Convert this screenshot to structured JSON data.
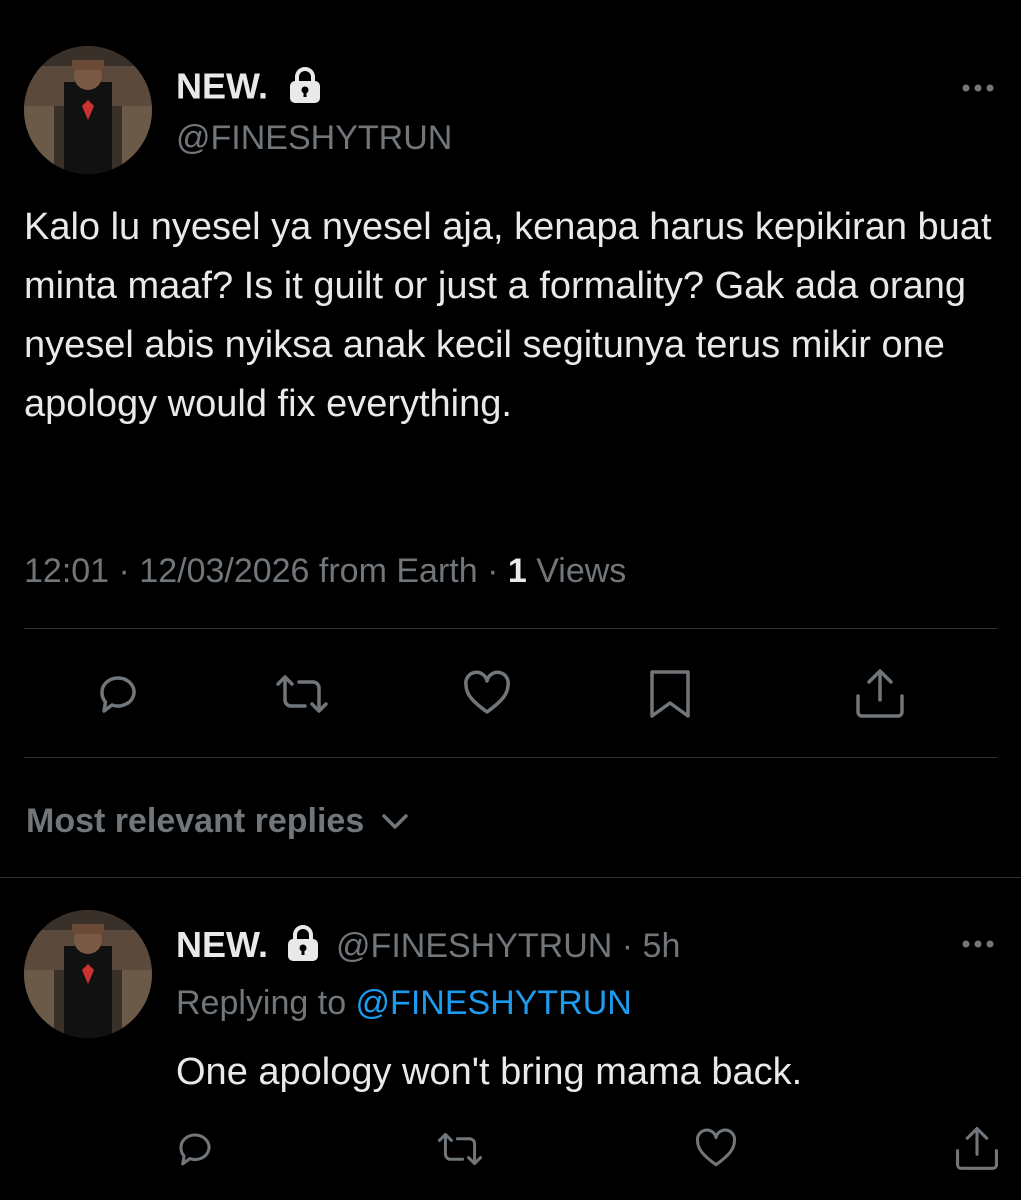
{
  "tweet": {
    "display_name": "NEW.",
    "handle": "@FINESHYTRUN",
    "text": "Kalo lu nyesel ya nyesel aja, kenapa harus kepikiran buat minta maaf? Is it guilt or just a formality? Gak ada orang nyesel abis nyiksa anak kecil segitunya terus mikir one apology would fix everything.",
    "meta_prefix": "12:01 · 12/03/2026 from Earth · ",
    "views_count": "1",
    "views_label": " Views"
  },
  "actions": {
    "reply_icon": "reply-icon",
    "retweet_icon": "retweet-icon",
    "like_icon": "heart-icon",
    "bookmark_icon": "bookmark-icon",
    "share_icon": "share-icon"
  },
  "replies_filter": {
    "label": "Most relevant replies"
  },
  "reply": {
    "display_name": "NEW.",
    "handle_time": "@FINESHYTRUN · 5h",
    "replying_prefix": "Replying to ",
    "replying_handle": "@FINESHYTRUN",
    "text": "One apology won't bring mama back."
  },
  "colors": {
    "background": "#000000",
    "text": "#e7e9ea",
    "secondary": "#71767b",
    "link": "#1d9bf0",
    "divider": "#2f3336"
  }
}
